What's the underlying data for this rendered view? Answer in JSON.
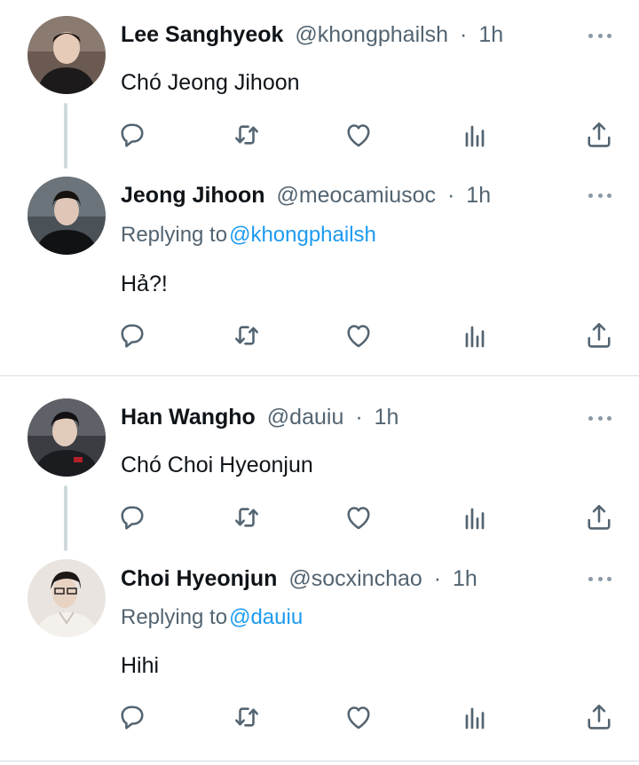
{
  "threads": [
    {
      "tweets": [
        {
          "name": "Lee Sanghyeok",
          "handle": "@khongphailsh",
          "time": "1h",
          "text": "Chó Jeong Jihoon",
          "replying_prefix": null,
          "replying_to": null,
          "avatar_color": "#5a4a44"
        },
        {
          "name": "Jeong Jihoon",
          "handle": "@meocamiusoc",
          "time": "1h",
          "text": "Hả?!",
          "replying_prefix": "Replying to",
          "replying_to": "@khongphailsh",
          "avatar_color": "#3d4348"
        }
      ]
    },
    {
      "tweets": [
        {
          "name": "Han Wangho",
          "handle": "@dauiu",
          "time": "1h",
          "text": "Chó Choi Hyeonjun",
          "replying_prefix": null,
          "replying_to": null,
          "avatar_color": "#2e2f33"
        },
        {
          "name": "Choi Hyeonjun",
          "handle": "@socxinchao",
          "time": "1h",
          "text": "Hihi",
          "replying_prefix": "Replying to",
          "replying_to": "@dauiu",
          "avatar_color": "#d8cfc8"
        }
      ]
    }
  ],
  "separator": "·",
  "icons": [
    "reply-icon",
    "retweet-icon",
    "like-icon",
    "views-icon",
    "share-icon"
  ],
  "colors": {
    "mention": "#1d9bf0",
    "secondary": "#536471",
    "icon": "#536471"
  }
}
